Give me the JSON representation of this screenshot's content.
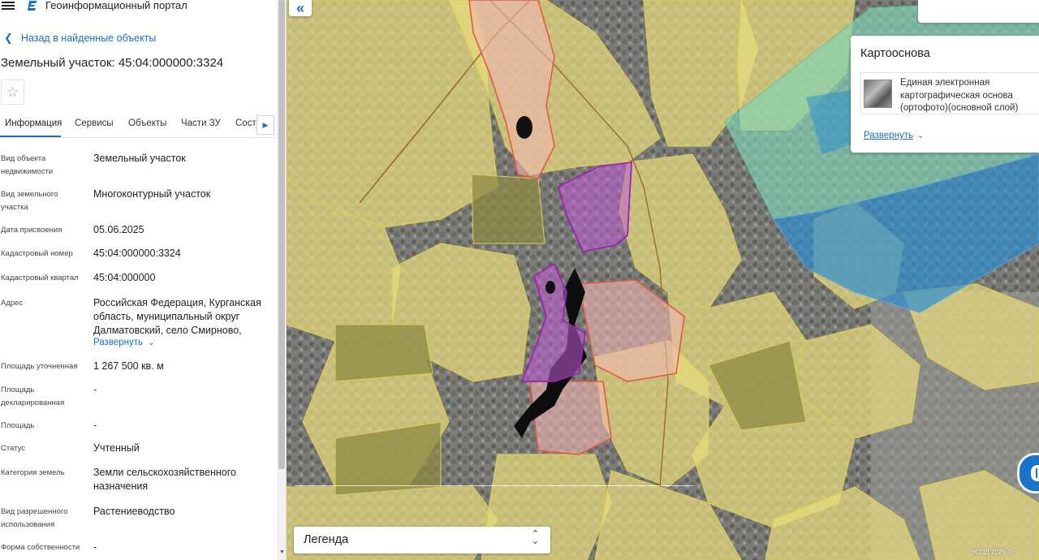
{
  "header": {
    "portal_name": "Геоинформационный портал"
  },
  "navigation": {
    "back_label": "Назад в найденные объекты"
  },
  "object": {
    "title": "Земельный участок: 45:04:000000:3324"
  },
  "tabs": [
    {
      "label": "Информация",
      "active": true
    },
    {
      "label": "Сервисы"
    },
    {
      "label": "Объекты"
    },
    {
      "label": "Части ЗУ"
    },
    {
      "label": "Соста"
    }
  ],
  "details": {
    "object_type": {
      "label": "Вид объекта недвижимости",
      "value": "Земельный участок"
    },
    "parcel_type": {
      "label": "Вид земельного участка",
      "value": "Многоконтурный участок"
    },
    "assign_date": {
      "label": "Дата присвоения",
      "value": "05.06.2025"
    },
    "cadastral_number": {
      "label": "Кадастровый номер",
      "value": "45:04:000000:3324"
    },
    "cadastral_quarter": {
      "label": "Кадастровый квартал",
      "value": "45:04:000000"
    },
    "address": {
      "label": "Адрес",
      "value": "Российская Федерация, Курганская область, муниципальный округ Далматовский, село Смирново,",
      "expand_label": "Развернуть"
    },
    "area_refined": {
      "label": "Площадь уточненная",
      "value": "1 267 500 кв. м"
    },
    "area_declared": {
      "label": "Площадь декларированная",
      "value": "-"
    },
    "area": {
      "label": "Площадь",
      "value": "-"
    },
    "status": {
      "label": "Статус",
      "value": "Учтенный"
    },
    "land_category": {
      "label": "Категория земель",
      "value": "Земли сельскохозяйственного назначения"
    },
    "permitted_use": {
      "label": "Вид разрешенного использования",
      "value": "Растениеводство"
    },
    "ownership": {
      "label": "Форма собственности",
      "value": "-"
    }
  },
  "basemap": {
    "title": "Картооснова",
    "layer_name": "Единая электронная картографическая основа (ортофото)(основной слой)",
    "expand_label": "Развернуть"
  },
  "legend": {
    "label": "Легенда"
  },
  "map": {
    "copyright": "НСПД 2025 ©"
  },
  "icons": {
    "menu": "hamburger-icon",
    "logo": "portal-logo-icon",
    "back": "chevron-left-icon",
    "favorite": "star-icon",
    "collapse": "double-chevron-left-icon",
    "legend_toggle": "updown-chevron-icon",
    "chat": "chat-icon"
  },
  "colors": {
    "accent": "#1a6fc8",
    "parcel_fill": "#e8dc7e",
    "parcel_stroke": "#d9c94a",
    "selected_parcel": "#c05cd6",
    "settlement": "#e35a43",
    "forest_zone": "#2f8fd0",
    "green_zone": "#7fd6b8"
  }
}
